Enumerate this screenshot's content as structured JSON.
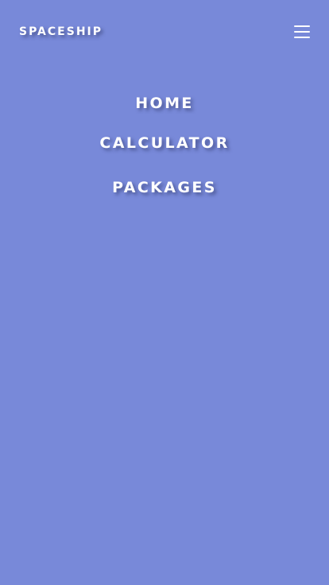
{
  "header": {
    "brand": "SPACESHIP",
    "menu_icon": "hamburger-menu-icon"
  },
  "nav": {
    "items": [
      {
        "label": "HOME"
      },
      {
        "label": "CALCULATOR"
      },
      {
        "label": "PACKAGES"
      }
    ]
  },
  "colors": {
    "background": "#7889d9",
    "text": "#ffffff"
  }
}
